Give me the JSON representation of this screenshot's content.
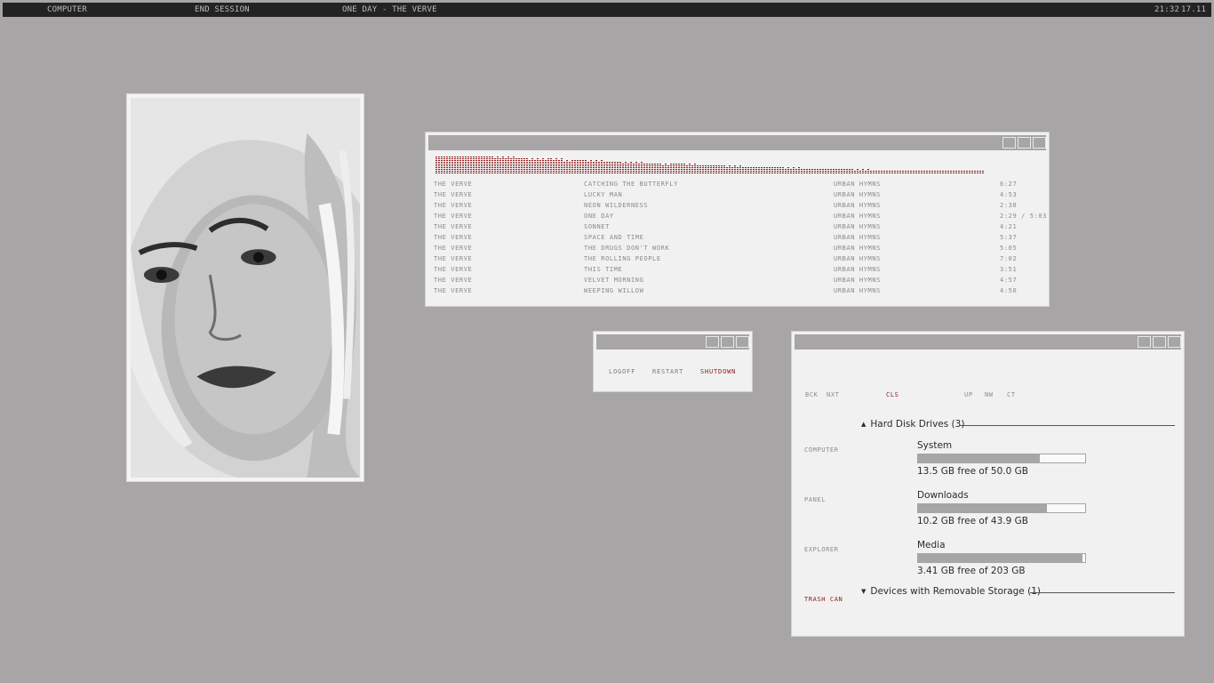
{
  "topbar": {
    "computer": "COMPUTER",
    "end_session": "END SESSION",
    "now_playing": "ONE DAY - THE VERVE",
    "time": "21:32",
    "date": "17.11"
  },
  "player": {
    "tracks": [
      {
        "artist": "THE VERVE",
        "title": "CATCHING THE BUTTERFLY",
        "album": "URBAN HYMNS",
        "time": "6:27"
      },
      {
        "artist": "THE VERVE",
        "title": "LUCKY MAN",
        "album": "URBAN HYMNS",
        "time": "4:53"
      },
      {
        "artist": "THE VERVE",
        "title": "NEON WILDERNESS",
        "album": "URBAN HYMNS",
        "time": "2:38"
      },
      {
        "artist": "THE VERVE",
        "title": "ONE DAY",
        "album": "URBAN HYMNS",
        "time": "2:29 / 5:03"
      },
      {
        "artist": "THE VERVE",
        "title": "SONNET",
        "album": "URBAN HYMNS",
        "time": "4:21"
      },
      {
        "artist": "THE VERVE",
        "title": "SPACE AND TIME",
        "album": "URBAN HYMNS",
        "time": "5:37"
      },
      {
        "artist": "THE VERVE",
        "title": "THE DRUGS DON'T WORK",
        "album": "URBAN HYMNS",
        "time": "5:05"
      },
      {
        "artist": "THE VERVE",
        "title": "THE ROLLING PEOPLE",
        "album": "URBAN HYMNS",
        "time": "7:02"
      },
      {
        "artist": "THE VERVE",
        "title": "THIS TIME",
        "album": "URBAN HYMNS",
        "time": "3:51"
      },
      {
        "artist": "THE VERVE",
        "title": "VELVET MORNING",
        "album": "URBAN HYMNS",
        "time": "4:57"
      },
      {
        "artist": "THE VERVE",
        "title": "WEEPING WILLOW",
        "album": "URBAN HYMNS",
        "time": "4:50"
      }
    ]
  },
  "session": {
    "logoff": "LOGOFF",
    "restart": "RESTART",
    "shutdown": "SHUTDOWN"
  },
  "explorer": {
    "nav": {
      "back": "BCK",
      "next": "NXT",
      "cls": "CLS",
      "up": "UP",
      "new": "NW",
      "cut": "CT"
    },
    "sidebar": {
      "computer": "COMPUTER",
      "panel": "PANEL",
      "explorer": "EXPLORER",
      "trash": "TRASH CAN"
    },
    "hdd_group": "Hard Disk Drives (3)",
    "removable_group": "Devices with Removable Storage (1)",
    "drives": [
      {
        "name": "System",
        "free": "13.5 GB free of 50.0 GB",
        "used_fraction": 0.73
      },
      {
        "name": "Downloads",
        "free": "10.2 GB free of 43.9 GB",
        "used_fraction": 0.77
      },
      {
        "name": "Media",
        "free": "3.41 GB free of 203 GB",
        "used_fraction": 0.983
      }
    ]
  },
  "colors": {
    "background": "#a7a5a6",
    "accent": "#8b1a1a",
    "window": "#f1f1f1"
  }
}
